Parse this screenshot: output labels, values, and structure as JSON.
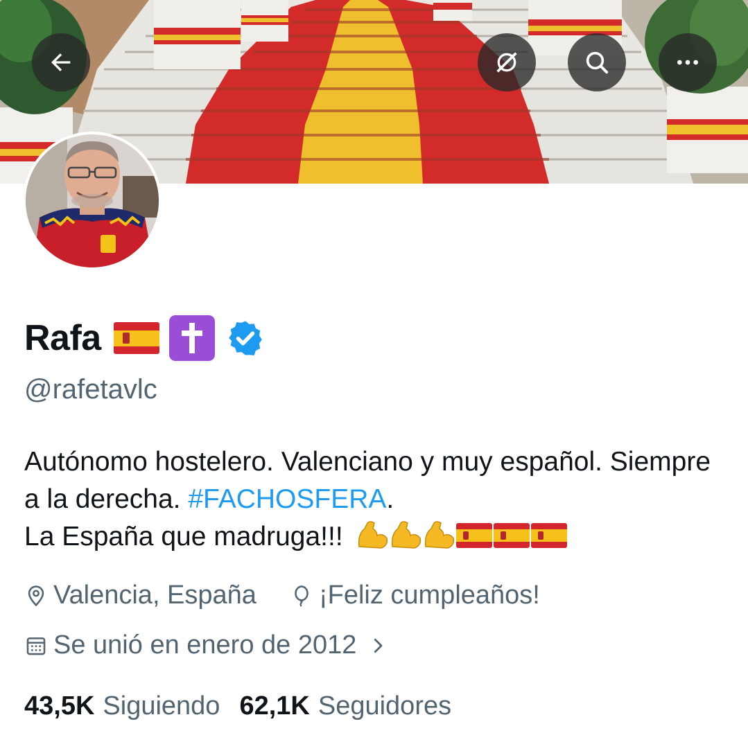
{
  "profile": {
    "name": "Rafa",
    "handle": "@rafetavlc",
    "bio_before_hashtag": "Autónomo hostelero. Valenciano y muy español. Siempre a la derecha. ",
    "hashtag": "#FACHOSFERA",
    "bio_after_hashtag": ".",
    "bio_line3": "La España que madruga!!!",
    "emojis": [
      "flexed-biceps",
      "flexed-biceps",
      "flexed-biceps",
      "flag-spain",
      "flag-spain",
      "flag-spain"
    ],
    "verified": true
  },
  "meta": {
    "location": "Valencia, España",
    "birthday": "¡Feliz cumpleaños!",
    "joined": "Se unió en enero de 2012"
  },
  "stats": {
    "following_count": "43,5K",
    "following_label": "Siguiendo",
    "followers_count": "62,1K",
    "followers_label": "Seguidores"
  },
  "icons": {
    "back": "arrow-left-icon",
    "grok": "grok-icon",
    "search": "search-icon",
    "more": "more-icon"
  },
  "colors": {
    "link": "#1d9bf0",
    "secondary_text": "#536471",
    "verified_badge": "#1d9bf0",
    "flag_red": "#d2262c",
    "flag_yellow": "#f7c11c"
  }
}
